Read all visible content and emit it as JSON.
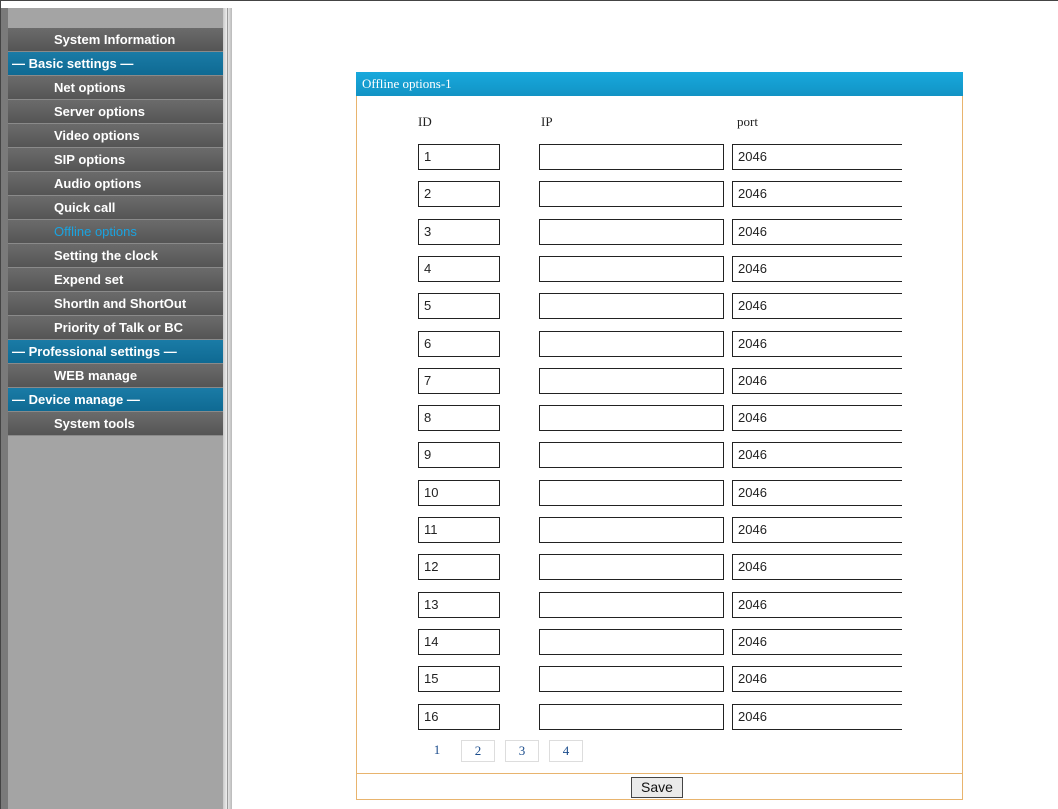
{
  "sidebar": {
    "items": [
      {
        "label": "System Information",
        "type": "item"
      },
      {
        "label": "— Basic settings —",
        "type": "section"
      },
      {
        "label": "Net options",
        "type": "item"
      },
      {
        "label": "Server options",
        "type": "item"
      },
      {
        "label": "Video options",
        "type": "item"
      },
      {
        "label": "SIP options",
        "type": "item"
      },
      {
        "label": "Audio options",
        "type": "item"
      },
      {
        "label": "Quick call",
        "type": "item"
      },
      {
        "label": "Offline options",
        "type": "active"
      },
      {
        "label": "Setting the clock",
        "type": "item"
      },
      {
        "label": "Expend set",
        "type": "item"
      },
      {
        "label": "ShortIn and ShortOut",
        "type": "item"
      },
      {
        "label": "Priority of Talk or BC",
        "type": "item"
      },
      {
        "label": "— Professional settings —",
        "type": "section"
      },
      {
        "label": "WEB manage",
        "type": "item"
      },
      {
        "label": "— Device manage —",
        "type": "section"
      },
      {
        "label": "System tools",
        "type": "item"
      }
    ]
  },
  "panel": {
    "title": "Offline options-1",
    "headers": {
      "id": "ID",
      "ip": "IP",
      "port": "port"
    },
    "rows": [
      {
        "id": "1",
        "ip": "",
        "port": "2046"
      },
      {
        "id": "2",
        "ip": "",
        "port": "2046"
      },
      {
        "id": "3",
        "ip": "",
        "port": "2046"
      },
      {
        "id": "4",
        "ip": "",
        "port": "2046"
      },
      {
        "id": "5",
        "ip": "",
        "port": "2046"
      },
      {
        "id": "6",
        "ip": "",
        "port": "2046"
      },
      {
        "id": "7",
        "ip": "",
        "port": "2046"
      },
      {
        "id": "8",
        "ip": "",
        "port": "2046"
      },
      {
        "id": "9",
        "ip": "",
        "port": "2046"
      },
      {
        "id": "10",
        "ip": "",
        "port": "2046"
      },
      {
        "id": "11",
        "ip": "",
        "port": "2046"
      },
      {
        "id": "12",
        "ip": "",
        "port": "2046"
      },
      {
        "id": "13",
        "ip": "",
        "port": "2046"
      },
      {
        "id": "14",
        "ip": "",
        "port": "2046"
      },
      {
        "id": "15",
        "ip": "",
        "port": "2046"
      },
      {
        "id": "16",
        "ip": "",
        "port": "2046"
      }
    ],
    "pages": [
      "1",
      "2",
      "3",
      "4"
    ],
    "current_page": "1",
    "save_label": "Save"
  },
  "colors": {
    "section_blue": "#0f6a93",
    "active_text": "#1aa3e0",
    "panel_border": "#e8b46e",
    "header_blue": "#18a9dd"
  }
}
